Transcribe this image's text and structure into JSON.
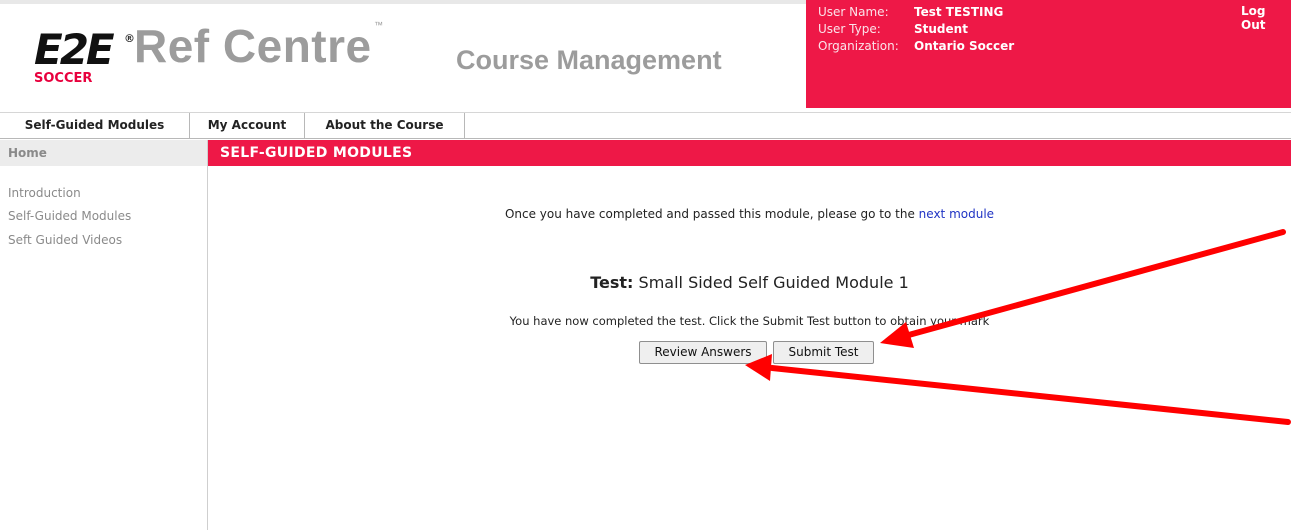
{
  "header": {
    "logo_mark": "E2E",
    "logo_sub": "SOCCER",
    "logo_reg": "®",
    "brand": "Ref Centre",
    "brand_tm": "™",
    "subtitle": "Course Management"
  },
  "user": {
    "name_label": "User Name:",
    "name_value": "Test TESTING",
    "type_label": "User Type:",
    "type_value": "Student",
    "org_label": "Organization:",
    "org_value": "Ontario Soccer",
    "logout": "Log Out"
  },
  "nav": {
    "tabs": [
      {
        "label": "Self-Guided Modules"
      },
      {
        "label": "My Account"
      },
      {
        "label": "About the Course"
      }
    ]
  },
  "sidebar": {
    "home": "Home",
    "items": [
      {
        "label": "Introduction"
      },
      {
        "label": "Self-Guided Modules"
      },
      {
        "label": "Seft Guided Videos"
      }
    ]
  },
  "main": {
    "title": "SELF-GUIDED MODULES",
    "notice_text": "Once you have completed and passed this module, please go to the ",
    "notice_link": "next module",
    "test_label": "Test:",
    "test_name": " Small Sided Self Guided Module 1",
    "completed_text": "You have now completed the test. Click the Submit Test button to obtain your mark",
    "review_button": "Review Answers",
    "submit_button": "Submit Test"
  },
  "colors": {
    "brand_red": "#ee1847",
    "link_blue": "#2034c4",
    "arrow_red": "#ff0000"
  }
}
